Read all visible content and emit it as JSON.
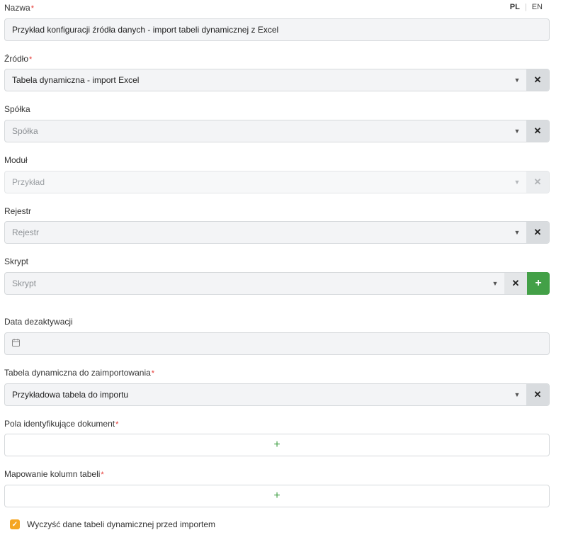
{
  "lang": {
    "pl": "PL",
    "en": "EN"
  },
  "required_mark": "*",
  "nazwa": {
    "label": "Nazwa",
    "value": "Przykład konfiguracji źródła danych - import tabeli dynamicznej z Excel"
  },
  "zrodlo": {
    "label": "Źródło",
    "value": "Tabela dynamiczna - import Excel"
  },
  "spolka": {
    "label": "Spółka",
    "placeholder": "Spółka"
  },
  "modul": {
    "label": "Moduł",
    "placeholder": "Przykład"
  },
  "rejestr": {
    "label": "Rejestr",
    "placeholder": "Rejestr"
  },
  "skrypt": {
    "label": "Skrypt",
    "placeholder": "Skrypt"
  },
  "data_dezaktywacji": {
    "label": "Data dezaktywacji",
    "value": ""
  },
  "tabela": {
    "label": "Tabela dynamiczna do zaimportowania",
    "value": "Przykładowa tabela do importu"
  },
  "pola": {
    "label": "Pola identyfikujące dokument"
  },
  "mapowanie": {
    "label": "Mapowanie kolumn tabeli"
  },
  "wyczysc": {
    "label": "Wyczyść dane tabeli dynamicznej przed importem",
    "checked": true
  },
  "icons": {
    "caret": "▼",
    "clear": "✕",
    "plus": "+",
    "check": "✓"
  },
  "colors": {
    "accent_green": "#43a047",
    "required_red": "#e53935",
    "checkbox_orange": "#f5a623"
  }
}
